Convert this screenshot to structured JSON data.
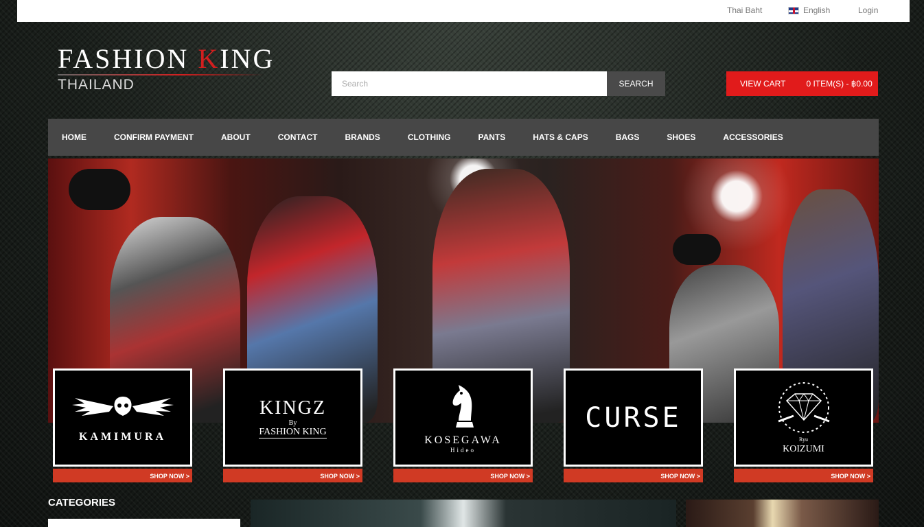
{
  "topbar": {
    "currency": "Thai Baht",
    "language": "English",
    "login": "Login",
    "language_icon": "uk-flag-icon"
  },
  "logo": {
    "main_prefix": "FASHION ",
    "main_k": "K",
    "main_suffix": "ING",
    "sub": "THAILAND"
  },
  "search": {
    "placeholder": "Search",
    "button": "SEARCH"
  },
  "cart": {
    "view_label": "VIEW CART",
    "summary": "0 ITEM(S) - ฿0.00"
  },
  "nav": {
    "items": [
      "HOME",
      "CONFIRM PAYMENT",
      "ABOUT",
      "CONTACT",
      "BRANDS",
      "CLOTHING",
      "PANTS",
      "HATS & CAPS",
      "BAGS",
      "SHOES",
      "ACCESSORIES"
    ]
  },
  "brands": [
    {
      "name": "KAMIMURA",
      "shop": "SHOP NOW >"
    },
    {
      "name": "KINGZ",
      "by": "By",
      "sub": "FASHION KING",
      "shop": "SHOP NOW >"
    },
    {
      "name": "KOSEGAWA",
      "sub": "Hideo",
      "shop": "SHOP NOW >"
    },
    {
      "name": "CURSE",
      "shop": "SHOP NOW >"
    },
    {
      "name": "KOIZUMI",
      "ryu": "Ryu",
      "shop": "SHOP NOW >"
    }
  ],
  "sidebar": {
    "categories_title": "CATEGORIES"
  },
  "colors": {
    "accent": "#e11b1b",
    "nav_bg": "#474747",
    "shop_bar": "#d03a24"
  }
}
